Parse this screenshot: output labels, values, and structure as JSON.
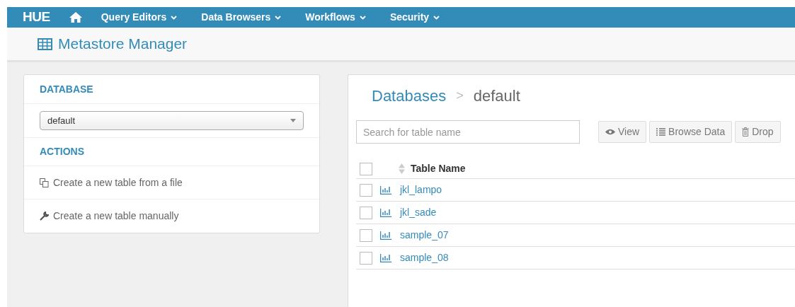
{
  "navbar": {
    "logo": "HUE",
    "menus": [
      {
        "label": "Query Editors"
      },
      {
        "label": "Data Browsers"
      },
      {
        "label": "Workflows"
      },
      {
        "label": "Security"
      }
    ]
  },
  "page_title": "Metastore Manager",
  "sidebar": {
    "database_heading": "DATABASE",
    "database_select": "default",
    "actions_heading": "ACTIONS",
    "actions": [
      {
        "kind": "file",
        "label": "Create a new table from a file"
      },
      {
        "kind": "manual",
        "label": "Create a new table manually"
      }
    ]
  },
  "breadcrumb": {
    "root": "Databases",
    "separator": ">",
    "current": "default"
  },
  "search": {
    "placeholder": "Search for table name"
  },
  "buttons": [
    {
      "kind": "view",
      "label": "View"
    },
    {
      "kind": "browse",
      "label": "Browse Data"
    },
    {
      "kind": "drop",
      "label": "Drop"
    }
  ],
  "table": {
    "select_all_checked": false,
    "column": "Table Name",
    "rows": [
      {
        "name": "jkl_lampo",
        "checked": false
      },
      {
        "name": "jkl_sade",
        "checked": false
      },
      {
        "name": "sample_07",
        "checked": false
      },
      {
        "name": "sample_08",
        "checked": false
      }
    ]
  }
}
